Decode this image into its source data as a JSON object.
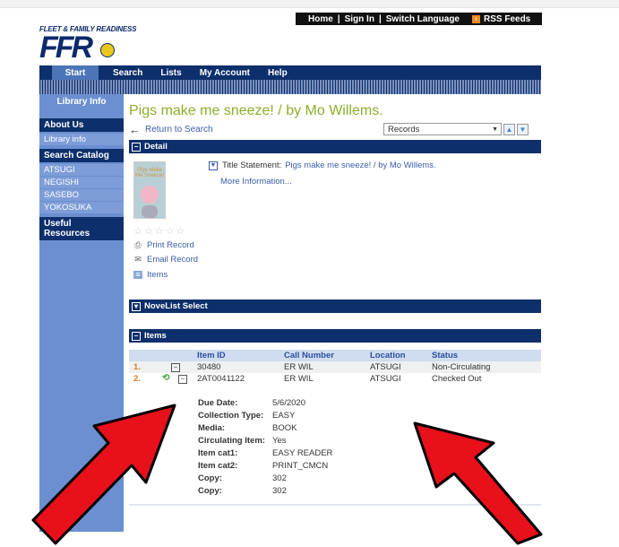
{
  "top_links": {
    "home": "Home",
    "sign_in": "Sign In",
    "switch_language": "Switch Language",
    "rss": "RSS Feeds",
    "sep": "|"
  },
  "logo": {
    "small": "FLEET & FAMILY READINESS",
    "big": "FFR"
  },
  "nav": [
    "Start",
    "Search",
    "Lists",
    "My Account",
    "Help"
  ],
  "sidebar": {
    "tab": "Library Info",
    "about_us": "About Us",
    "library_info": "Library info",
    "search_catalog": "Search Catalog",
    "catalogs": [
      "ATSUGI",
      "NEGISHI",
      "SASEBO",
      "YOKOSUKA"
    ],
    "useful": "Useful Resources"
  },
  "main": {
    "title": "Pigs make me sneeze! / by Mo Willems.",
    "return_label": "Return to Search",
    "records_select": "Records",
    "detail_header": "Detail",
    "title_statement_label": "Title Statement:",
    "title_statement_value": "Pigs make me sneeze! / by Mo Willems.",
    "more_info": "More Information...",
    "cover_text": "Pigs Make Me Sneeze!",
    "stars": "☆☆☆☆☆",
    "actions": {
      "print": "Print Record",
      "email": "Email Record",
      "items": "Items"
    },
    "novelist_header": "NoveList Select",
    "items_header": "Items"
  },
  "items": {
    "columns": [
      "Item ID",
      "Call Number",
      "Location",
      "Status"
    ],
    "rows": [
      {
        "num": "1.",
        "id": "30480",
        "call": "ER WIL",
        "location": "ATSUGI",
        "status": "Non-Circulating"
      },
      {
        "num": "2.",
        "id": "2AT0041122",
        "call": "ER WIL",
        "location": "ATSUGI",
        "status": "Checked Out"
      }
    ],
    "details": [
      {
        "label": "Due Date:",
        "value": "5/6/2020"
      },
      {
        "label": "Collection Type:",
        "value": "EASY"
      },
      {
        "label": "Media:",
        "value": "BOOK"
      },
      {
        "label": "Circulating Item:",
        "value": "Yes"
      },
      {
        "label": "Item cat1:",
        "value": "EASY READER"
      },
      {
        "label": "Item cat2:",
        "value": "PRINT_CMCN"
      },
      {
        "label": "Copy:",
        "value": "302"
      },
      {
        "label": "Copy:",
        "value": "302"
      }
    ]
  },
  "colors": {
    "nav": "#0d2f6b",
    "sidebar": "#6b8fd0",
    "title": "#8cae2a",
    "arrow": "#e8101a"
  }
}
